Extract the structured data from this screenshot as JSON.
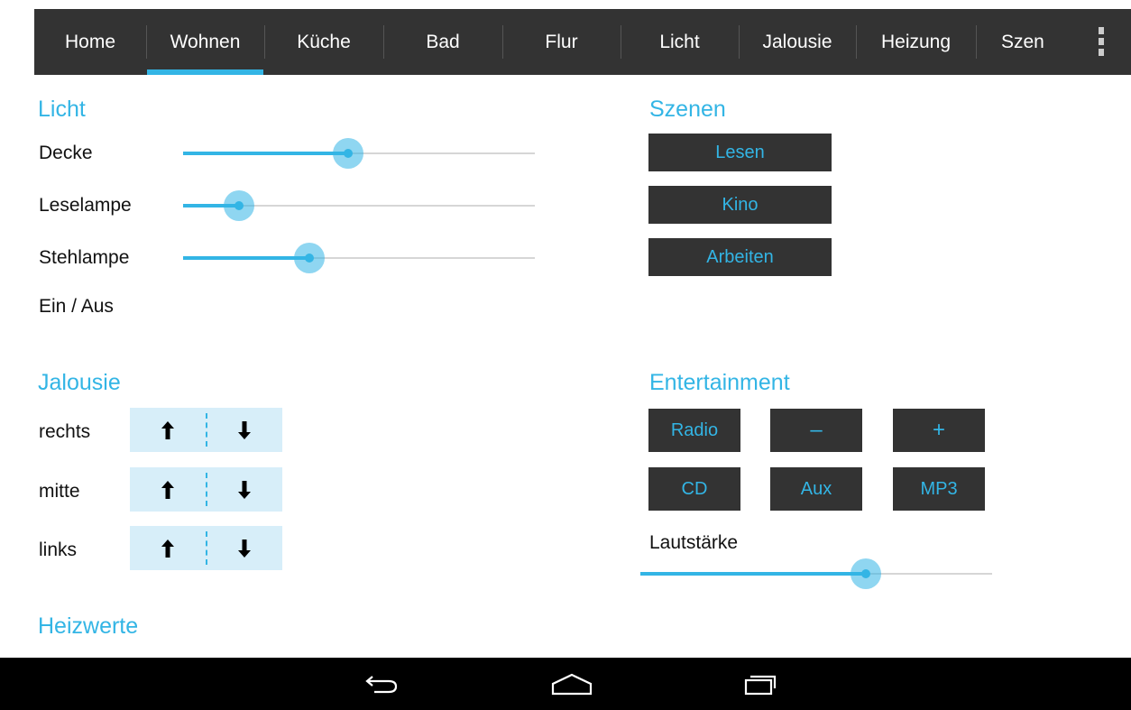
{
  "tabs": [
    {
      "label": "Home",
      "active": false
    },
    {
      "label": "Wohnen",
      "active": true
    },
    {
      "label": "Küche",
      "active": false
    },
    {
      "label": "Bad",
      "active": false
    },
    {
      "label": "Flur",
      "active": false
    },
    {
      "label": "Licht",
      "active": false
    },
    {
      "label": "Jalousie",
      "active": false
    },
    {
      "label": "Heizung",
      "active": false
    },
    {
      "label": "Szen",
      "active": false
    }
  ],
  "licht": {
    "title": "Licht",
    "sliders": [
      {
        "label": "Decke",
        "value": 0.47
      },
      {
        "label": "Leselampe",
        "value": 0.16
      },
      {
        "label": "Stehlampe",
        "value": 0.36
      }
    ],
    "toggle_label": "Ein / Aus"
  },
  "szenen": {
    "title": "Szenen",
    "buttons": [
      "Lesen",
      "Kino",
      "Arbeiten"
    ]
  },
  "jalousie": {
    "title": "Jalousie",
    "rows": [
      "rechts",
      "mitte",
      "links"
    ]
  },
  "entertainment": {
    "title": "Entertainment",
    "buttons": [
      "Radio",
      "–",
      "+",
      "CD",
      "Aux",
      "MP3"
    ],
    "volume_label": "Lautstärke",
    "volume_value": 0.64
  },
  "heizwerte": {
    "title": "Heizwerte"
  },
  "colors": {
    "accent": "#33b5e5",
    "tab_bar": "#333333",
    "button_bg": "#333333",
    "jalousie_bg": "#d7eef9"
  }
}
